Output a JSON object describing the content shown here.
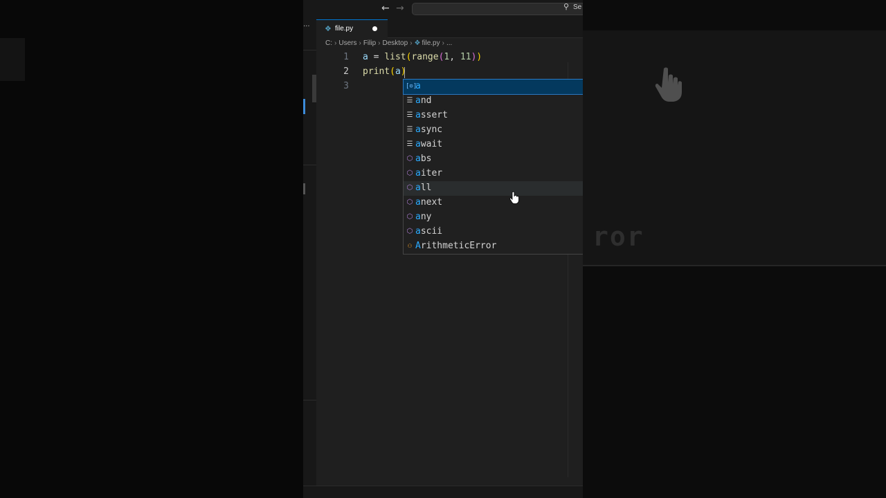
{
  "search": {
    "placeholder_fragment": "Se"
  },
  "tab": {
    "label": "file.py",
    "dirty": true
  },
  "breadcrumb": [
    "C:",
    "Users",
    "Filip",
    "Desktop",
    "file.py",
    "..."
  ],
  "editor": {
    "line_numbers": [
      "1",
      "2",
      "3"
    ],
    "active_line": "2",
    "line1": {
      "a": "a",
      "eq": " = ",
      "list": "list",
      "p1": "(",
      "range": "range",
      "p2": "(",
      "n1": "1",
      "comma": ", ",
      "n2": "11",
      "p3": ")",
      "p4": ")"
    },
    "line2": {
      "print": "print",
      "p1": "(",
      "a": "a",
      "p2": ")"
    }
  },
  "suggestions": [
    {
      "match": "a",
      "rest": "",
      "kind": "variable",
      "icon": "variable-icon"
    },
    {
      "match": "a",
      "rest": "nd",
      "kind": "keyword",
      "icon": "keyword-icon"
    },
    {
      "match": "a",
      "rest": "ssert",
      "kind": "keyword",
      "icon": "keyword-icon"
    },
    {
      "match": "a",
      "rest": "sync",
      "kind": "keyword",
      "icon": "keyword-icon"
    },
    {
      "match": "a",
      "rest": "wait",
      "kind": "keyword",
      "icon": "keyword-icon"
    },
    {
      "match": "a",
      "rest": "bs",
      "kind": "function",
      "icon": "method-icon"
    },
    {
      "match": "a",
      "rest": "iter",
      "kind": "function",
      "icon": "method-icon"
    },
    {
      "match": "a",
      "rest": "ll",
      "kind": "function",
      "icon": "method-icon"
    },
    {
      "match": "a",
      "rest": "next",
      "kind": "function",
      "icon": "method-icon"
    },
    {
      "match": "a",
      "rest": "ny",
      "kind": "function",
      "icon": "method-icon"
    },
    {
      "match": "a",
      "rest": "scii",
      "kind": "function",
      "icon": "method-icon"
    },
    {
      "match": "A",
      "rest": "rithmeticError",
      "kind": "class",
      "icon": "class-icon"
    }
  ],
  "background": {
    "blurred_text": "ror"
  },
  "colors": {
    "accent": "#0078d4",
    "selection": "#04395e",
    "match_highlight": "#2aaaff"
  }
}
